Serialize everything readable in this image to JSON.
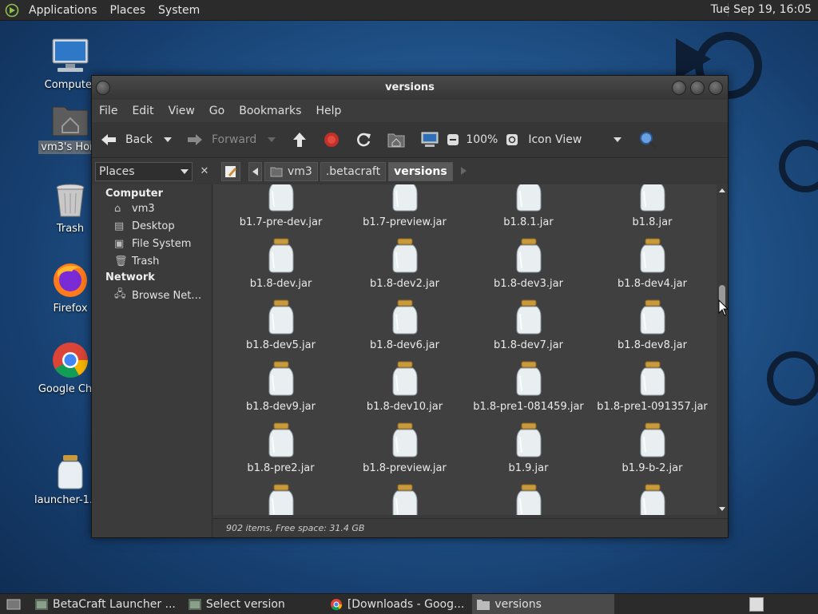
{
  "top_panel": {
    "menus": [
      "Applications",
      "Places",
      "System"
    ],
    "clock": "Tue Sep 19, 16:05"
  },
  "desktop_icons": [
    {
      "label": "Computer",
      "icon": "computer-icon"
    },
    {
      "label": "vm3's Hom",
      "icon": "home-folder-icon"
    },
    {
      "label": "Trash",
      "icon": "trash-icon"
    },
    {
      "label": "Firefox",
      "icon": "firefox-icon"
    },
    {
      "label": "Google Chro",
      "icon": "chrome-icon"
    },
    {
      "label": "launcher-1.09_",
      "icon": "jar-icon"
    }
  ],
  "window": {
    "title": "versions",
    "menu": [
      "File",
      "Edit",
      "View",
      "Go",
      "Bookmarks",
      "Help"
    ],
    "toolbar": {
      "back": "Back",
      "forward": "Forward",
      "zoom": "100%",
      "view_mode": "Icon View"
    },
    "places_label": "Places",
    "breadcrumbs": [
      "vm3",
      ".betacraft",
      "versions"
    ],
    "sidebar": {
      "sections": [
        {
          "title": "Computer",
          "items": [
            {
              "label": "vm3",
              "icon": "home-icon"
            },
            {
              "label": "Desktop",
              "icon": "desktop-icon"
            },
            {
              "label": "File System",
              "icon": "drive-icon"
            },
            {
              "label": "Trash",
              "icon": "trash-icon"
            }
          ]
        },
        {
          "title": "Network",
          "items": [
            {
              "label": "Browse Net…",
              "icon": "network-icon"
            }
          ]
        }
      ]
    },
    "files": [
      "b1.7-pre-dev.jar",
      "b1.7-preview.jar",
      "b1.8.1.jar",
      "b1.8.jar",
      "b1.8-dev.jar",
      "b1.8-dev2.jar",
      "b1.8-dev3.jar",
      "b1.8-dev4.jar",
      "b1.8-dev5.jar",
      "b1.8-dev6.jar",
      "b1.8-dev7.jar",
      "b1.8-dev8.jar",
      "b1.8-dev9.jar",
      "b1.8-dev10.jar",
      "b1.8-pre1-081459.jar",
      "b1.8-pre1-091357.jar",
      "b1.8-pre2.jar",
      "b1.8-preview.jar",
      "b1.9.jar",
      "b1.9-b-2.jar",
      "",
      "",
      "",
      ""
    ],
    "status": "902 items, Free space: 31.4 GB"
  },
  "taskbar": [
    {
      "label": "BetaCraft Launcher ...",
      "active": false
    },
    {
      "label": "Select version",
      "active": false
    },
    {
      "label": "[Downloads - Goog...",
      "active": false
    },
    {
      "label": "versions",
      "active": true
    }
  ]
}
